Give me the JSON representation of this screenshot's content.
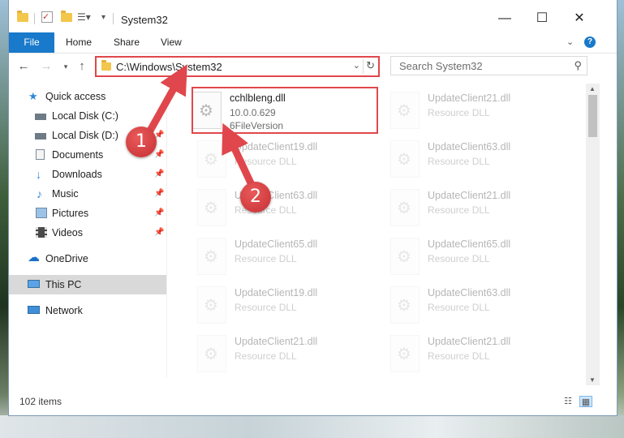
{
  "window": {
    "title": "System32"
  },
  "ribbon": {
    "tabs": [
      "File",
      "Home",
      "Share",
      "View"
    ],
    "help_label": "?"
  },
  "address": {
    "path": "C:\\Windows\\System32",
    "search_placeholder": "Search System32"
  },
  "sidebar": {
    "items": [
      {
        "label": "Quick access",
        "icon": "star-icon",
        "pinned": false
      },
      {
        "label": "Local Disk (C:)",
        "icon": "drive-icon",
        "pinned": true
      },
      {
        "label": "Local Disk (D:)",
        "icon": "drive-icon",
        "pinned": true
      },
      {
        "label": "Documents",
        "icon": "documents-icon",
        "pinned": true
      },
      {
        "label": "Downloads",
        "icon": "download-arrow-icon",
        "pinned": true
      },
      {
        "label": "Music",
        "icon": "music-note-icon",
        "pinned": true
      },
      {
        "label": "Pictures",
        "icon": "pictures-icon",
        "pinned": true
      },
      {
        "label": "Videos",
        "icon": "videos-icon",
        "pinned": true
      },
      {
        "label": "OneDrive",
        "icon": "cloud-icon",
        "pinned": false
      },
      {
        "label": "This PC",
        "icon": "computer-icon",
        "pinned": false,
        "selected": true
      },
      {
        "label": "Network",
        "icon": "network-icon",
        "pinned": false
      }
    ]
  },
  "files": {
    "selected": {
      "name": "cchlbleng.dll",
      "version": "10.0.0.629",
      "description": "6FileVersion"
    },
    "left_column": [
      {
        "name": "UpdateClient19.dll",
        "type": "Resource DLL"
      },
      {
        "name": "UpdateClient63.dll",
        "type": "Resource DLL"
      },
      {
        "name": "UpdateClient65.dll",
        "type": "Resource DLL"
      },
      {
        "name": "UpdateClient19.dll",
        "type": "Resource DLL"
      },
      {
        "name": "UpdateClient21.dll",
        "type": "Resource DLL"
      }
    ],
    "right_column": [
      {
        "name": "UpdateClient21.dll",
        "type": "Resource DLL"
      },
      {
        "name": "UpdateClient63.dll",
        "type": "Resource DLL"
      },
      {
        "name": "UpdateClient21.dll",
        "type": "Resource DLL"
      },
      {
        "name": "UpdateClient65.dll",
        "type": "Resource DLL"
      },
      {
        "name": "UpdateClient63.dll",
        "type": "Resource DLL"
      },
      {
        "name": "UpdateClient21.dll",
        "type": "Resource DLL"
      }
    ]
  },
  "status": {
    "item_count": "102 items"
  },
  "annotations": {
    "step1": "1",
    "step2": "2",
    "accent": "#e0474c"
  }
}
